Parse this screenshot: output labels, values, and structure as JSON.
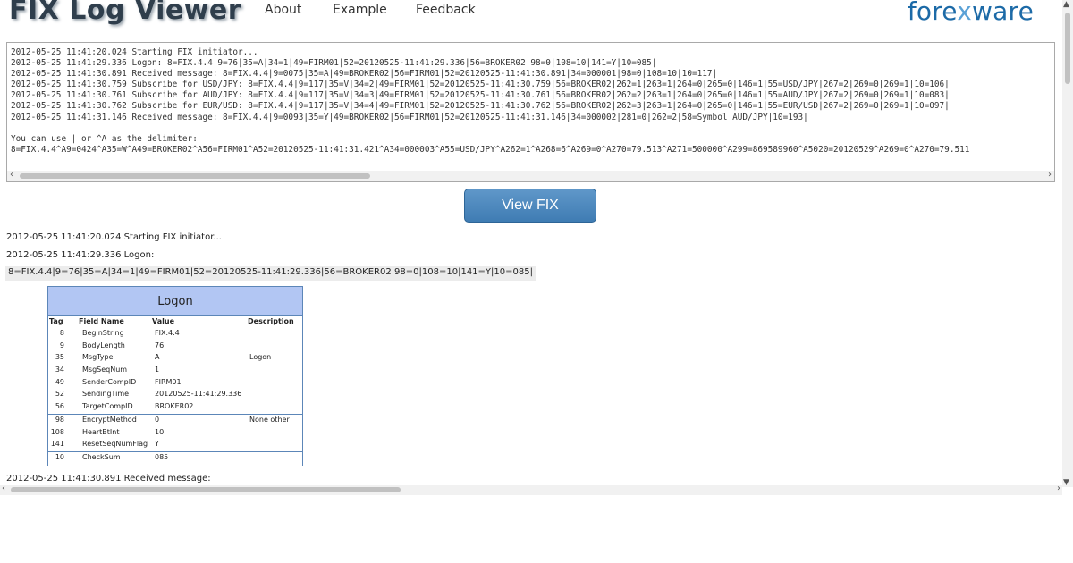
{
  "header": {
    "title": "FIX Log Viewer",
    "nav": [
      "About",
      "Example",
      "Feedback"
    ],
    "brand_prefix": "fore",
    "brand_x": "x",
    "brand_suffix": "ware"
  },
  "log_input": {
    "lines": [
      "2012-05-25 11:41:20.024 Starting FIX initiator...",
      "2012-05-25 11:41:29.336 Logon: 8=FIX.4.4|9=76|35=A|34=1|49=FIRM01|52=20120525-11:41:29.336|56=BROKER02|98=0|108=10|141=Y|10=085|",
      "2012-05-25 11:41:30.891 Received message: 8=FIX.4.4|9=0075|35=A|49=BROKER02|56=FIRM01|52=20120525-11:41:30.891|34=000001|98=0|108=10|10=117|",
      "2012-05-25 11:41:30.759 Subscribe for USD/JPY: 8=FIX.4.4|9=117|35=V|34=2|49=FIRM01|52=20120525-11:41:30.759|56=BROKER02|262=1|263=1|264=0|265=0|146=1|55=USD/JPY|267=2|269=0|269=1|10=106|",
      "2012-05-25 11:41:30.761 Subscribe for AUD/JPY: 8=FIX.4.4|9=117|35=V|34=3|49=FIRM01|52=20120525-11:41:30.761|56=BROKER02|262=2|263=1|264=0|265=0|146=1|55=AUD/JPY|267=2|269=0|269=1|10=083|",
      "2012-05-25 11:41:30.762 Subscribe for EUR/USD: 8=FIX.4.4|9=117|35=V|34=4|49=FIRM01|52=20120525-11:41:30.762|56=BROKER02|262=3|263=1|264=0|265=0|146=1|55=EUR/USD|267=2|269=0|269=1|10=097|",
      "2012-05-25 11:41:31.146 Received message: 8=FIX.4.4|9=0093|35=Y|49=BROKER02|56=FIRM01|52=20120525-11:41:31.146|34=000002|281=0|262=2|58=Symbol AUD/JPY|10=193|",
      "",
      "You can use | or ^A as the delimiter:",
      "8=FIX.4.4^A9=0424^A35=W^A49=BROKER02^A56=FIRM01^A52=20120525-11:41:31.421^A34=000003^A55=USD/JPY^A262=1^A268=6^A269=0^A270=79.513^A271=500000^A299=869589960^A5020=20120529^A269=0^A270=79.511"
    ]
  },
  "view_button": "View FIX",
  "output": {
    "line1": "2012-05-25 11:41:20.024 Starting FIX initiator...",
    "line2": "2012-05-25 11:41:29.336 Logon:",
    "raw_message": "8=FIX.4.4|9=76|35=A|34=1|49=FIRM01|52=20120525-11:41:29.336|56=BROKER02|98=0|108=10|141=Y|10=085|",
    "line3": "2012-05-25 11:41:30.891 Received message:"
  },
  "fix_table": {
    "title": "Logon",
    "columns": [
      "Tag",
      "Field Name",
      "Value",
      "Description"
    ],
    "header_rows": [
      {
        "tag": "8",
        "name": "BeginString",
        "value": "FIX.4.4",
        "desc": ""
      },
      {
        "tag": "9",
        "name": "BodyLength",
        "value": "76",
        "desc": ""
      },
      {
        "tag": "35",
        "name": "MsgType",
        "value": "A",
        "desc": "Logon"
      },
      {
        "tag": "34",
        "name": "MsgSeqNum",
        "value": "1",
        "desc": ""
      },
      {
        "tag": "49",
        "name": "SenderCompID",
        "value": "FIRM01",
        "desc": ""
      },
      {
        "tag": "52",
        "name": "SendingTime",
        "value": "20120525-11:41:29.336",
        "desc": ""
      },
      {
        "tag": "56",
        "name": "TargetCompID",
        "value": "BROKER02",
        "desc": ""
      }
    ],
    "body_rows": [
      {
        "tag": "98",
        "name": "EncryptMethod",
        "value": "0",
        "desc": "None other"
      },
      {
        "tag": "108",
        "name": "HeartBtInt",
        "value": "10",
        "desc": ""
      },
      {
        "tag": "141",
        "name": "ResetSeqNumFlag",
        "value": "Y",
        "desc": ""
      }
    ],
    "trailer_rows": [
      {
        "tag": "10",
        "name": "CheckSum",
        "value": "085",
        "desc": ""
      }
    ]
  },
  "colors": {
    "table_title_bg": "#b2c6f3",
    "table_border": "#5c86b8",
    "button_bg": "#4f8bc0",
    "brand": "#1c6aa7"
  }
}
